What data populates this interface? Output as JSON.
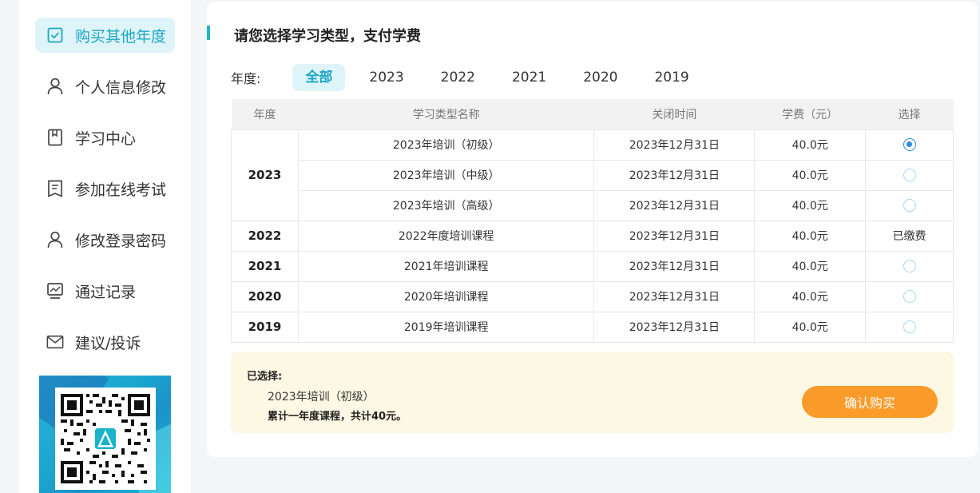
{
  "sidebar": {
    "items": [
      {
        "label": "购买其他年度",
        "icon": "checkbox-icon",
        "active": true
      },
      {
        "label": "个人信息修改",
        "icon": "user-icon",
        "active": false
      },
      {
        "label": "学习中心",
        "icon": "book-icon",
        "active": false
      },
      {
        "label": "参加在线考试",
        "icon": "exam-icon",
        "active": false
      },
      {
        "label": "修改登录密码",
        "icon": "user-icon",
        "active": false
      },
      {
        "label": "通过记录",
        "icon": "chart-icon",
        "active": false
      },
      {
        "label": "建议/投诉",
        "icon": "mail-icon",
        "active": false
      }
    ]
  },
  "main": {
    "title": "请您选择学习类型，支付学费",
    "year_filter": {
      "label": "年度:",
      "tabs": [
        "全部",
        "2023",
        "2022",
        "2021",
        "2020",
        "2019"
      ],
      "active": "全部"
    },
    "table": {
      "headers": [
        "年度",
        "学习类型名称",
        "关闭时间",
        "学费（元）",
        "选择"
      ],
      "rows": [
        {
          "year": "2023",
          "name": "2023年培训（初级）",
          "close": "2023年12月31日",
          "fee": "40.0元",
          "select": "radio-checked"
        },
        {
          "year": "",
          "name": "2023年培训（中级）",
          "close": "2023年12月31日",
          "fee": "40.0元",
          "select": "radio"
        },
        {
          "year": "",
          "name": "2023年培训（高级）",
          "close": "2023年12月31日",
          "fee": "40.0元",
          "select": "radio"
        },
        {
          "year": "2022",
          "name": "2022年度培训课程",
          "close": "2023年12月31日",
          "fee": "40.0元",
          "select": "已缴费"
        },
        {
          "year": "2021",
          "name": "2021年培训课程",
          "close": "2023年12月31日",
          "fee": "40.0元",
          "select": "radio"
        },
        {
          "year": "2020",
          "name": "2020年培训课程",
          "close": "2023年12月31日",
          "fee": "40.0元",
          "select": "radio"
        },
        {
          "year": "2019",
          "name": "2019年培训课程",
          "close": "2023年12月31日",
          "fee": "40.0元",
          "select": "radio"
        }
      ]
    },
    "summary": {
      "heading": "已选择:",
      "selected_item": "2023年培训（初级）",
      "total": "累计一年度课程，共计40元。",
      "confirm_label": "确认购买"
    }
  },
  "colors": {
    "accent": "#1aa7c4",
    "active_bg": "#dff4f9",
    "confirm": "#fb9b2a",
    "summary_bg": "#fdf8e3",
    "radio": "#2a8ee0"
  }
}
